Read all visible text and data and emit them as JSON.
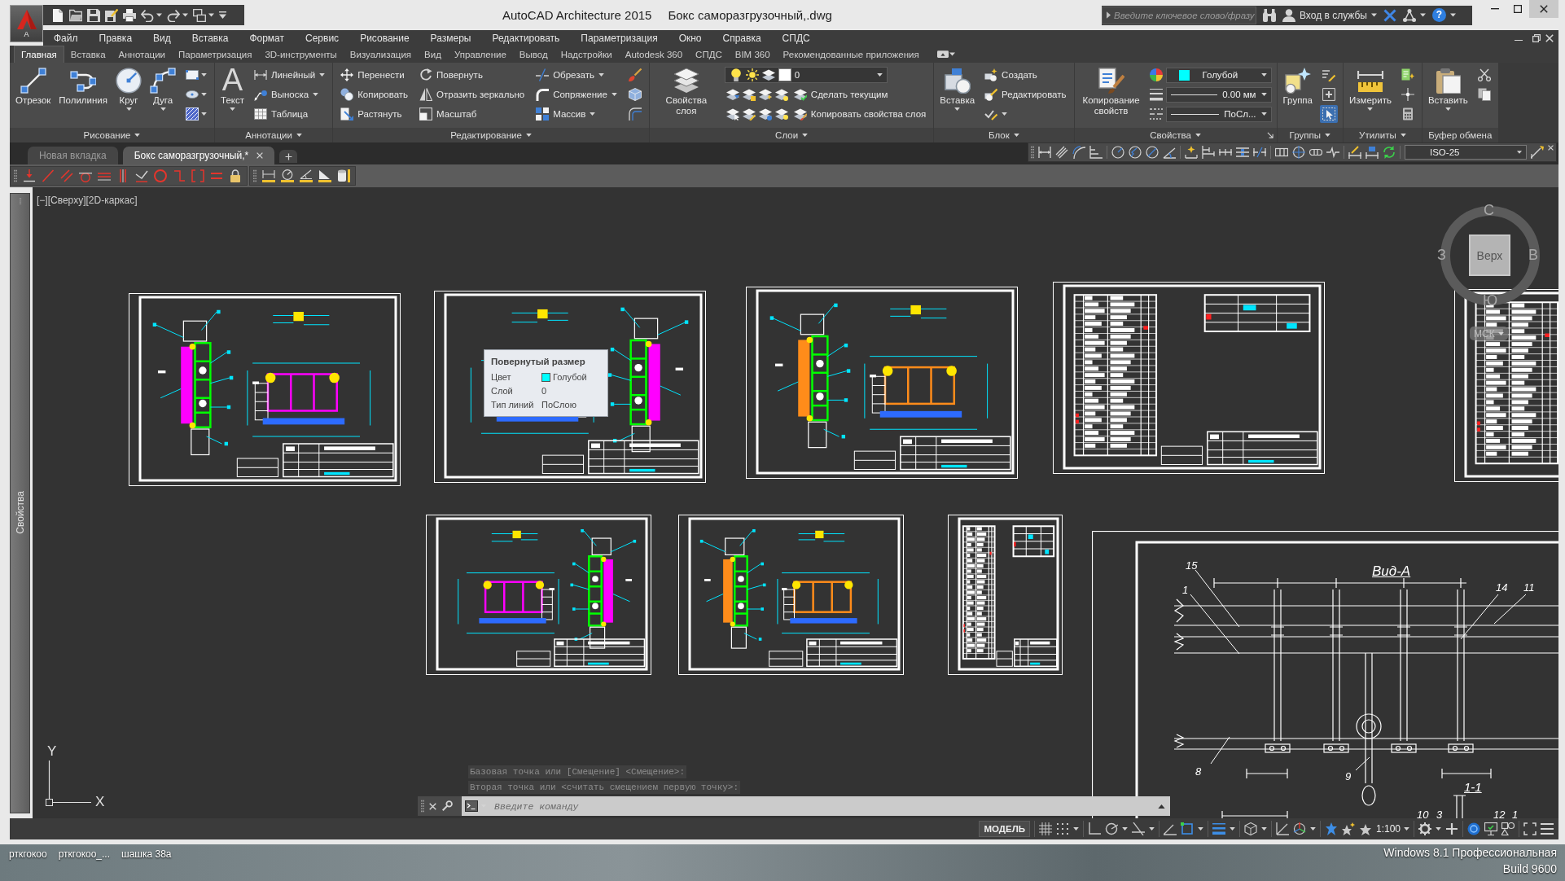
{
  "title_bar": {
    "app_label": "A",
    "app_name": "AutoCAD Architecture 2015",
    "file_name": "Бокс саморазгрузочный,.dwg",
    "search": {
      "placeholder": "Введите ключевое слово/фразу"
    },
    "sign_in": "Вход в службы",
    "help": "?"
  },
  "menu_bar": [
    "Файл",
    "Правка",
    "Вид",
    "Вставка",
    "Формат",
    "Сервис",
    "Рисование",
    "Размеры",
    "Редактировать",
    "Параметризация",
    "Окно",
    "Справка",
    "СПДС"
  ],
  "ribbon_tabs": [
    {
      "label": "Главная",
      "selected": true
    },
    {
      "label": "Вставка",
      "selected": false
    },
    {
      "label": "Аннотации",
      "selected": false
    },
    {
      "label": "Параметризация",
      "selected": false
    },
    {
      "label": "3D-инструменты",
      "selected": false
    },
    {
      "label": "Визуализация",
      "selected": false
    },
    {
      "label": "Вид",
      "selected": false
    },
    {
      "label": "Управление",
      "selected": false
    },
    {
      "label": "Вывод",
      "selected": false
    },
    {
      "label": "Надстройки",
      "selected": false
    },
    {
      "label": "Autodesk 360",
      "selected": false
    },
    {
      "label": "СПДС",
      "selected": false
    },
    {
      "label": "BIM 360",
      "selected": false
    },
    {
      "label": "Рекомендованные приложения",
      "selected": false
    }
  ],
  "ribbon_panels": [
    {
      "title": "Рисование",
      "menu": true,
      "launcher": false,
      "columns": [
        {
          "kind": "large",
          "label": "Отрезок",
          "dropdown": false
        },
        {
          "kind": "large",
          "label": "Полилиния",
          "dropdown": false
        },
        {
          "kind": "large",
          "label": "Круг",
          "dropdown": true
        },
        {
          "kind": "large",
          "label": "Дуга",
          "dropdown": true
        },
        {
          "kind": "icons",
          "items": [
            {
              "dropdown": true
            },
            {
              "dropdown": true
            },
            {
              "dropdown": true
            }
          ]
        }
      ]
    },
    {
      "title": "Аннотации",
      "menu": true,
      "launcher": false,
      "columns": [
        {
          "kind": "large",
          "glyph": "A",
          "label": "Текст",
          "dropdown": true
        },
        {
          "kind": "small",
          "items": [
            {
              "label": "Линейный",
              "dropdown": true
            },
            {
              "label": "Выноска",
              "dropdown": true
            },
            {
              "label": "Таблица",
              "dropdown": false
            }
          ]
        }
      ]
    },
    {
      "title": "Редактирование",
      "menu": true,
      "launcher": false,
      "columns": [
        {
          "kind": "small",
          "items": [
            {
              "label": "Перенести",
              "dropdown": false
            },
            {
              "label": "Копировать",
              "dropdown": false
            },
            {
              "label": "Растянуть",
              "dropdown": false
            }
          ]
        },
        {
          "kind": "small",
          "items": [
            {
              "label": "Повернуть",
              "dropdown": false
            },
            {
              "label": "Отразить зеркально",
              "dropdown": false
            },
            {
              "label": "Масштаб",
              "dropdown": false
            }
          ]
        },
        {
          "kind": "small",
          "items": [
            {
              "label": "Обрезать",
              "dropdown": true
            },
            {
              "label": "Сопряжение",
              "dropdown": true
            },
            {
              "label": "Массив",
              "dropdown": true
            }
          ]
        },
        {
          "kind": "icons",
          "items": [
            {
              "dropdown": false
            },
            {
              "dropdown": false
            },
            {
              "dropdown": false
            }
          ]
        }
      ]
    },
    {
      "title": "Слои",
      "menu": true,
      "launcher": false,
      "columns": [
        {
          "kind": "large",
          "label": "Свойства слоя",
          "dropdown": false
        },
        {
          "kind": "layers",
          "current_layer": "0",
          "items": [
            {
              "label": "Сделать текущим"
            },
            {
              "label": "Копировать свойства слоя"
            }
          ]
        }
      ]
    },
    {
      "title": "Блок",
      "menu": true,
      "launcher": false,
      "columns": [
        {
          "kind": "large",
          "label": "Вставка",
          "dropdown": true
        },
        {
          "kind": "small",
          "items": [
            {
              "label": "Создать",
              "dropdown": false
            },
            {
              "label": "Редактировать",
              "dropdown": false
            },
            {
              "dropdown": true
            }
          ]
        }
      ]
    },
    {
      "title": "Свойства",
      "menu": true,
      "launcher": true,
      "columns": [
        {
          "kind": "large",
          "label": "Копирование свойств",
          "dropdown": false
        },
        {
          "kind": "properties",
          "items": [
            {
              "kind": "color",
              "value": "Голубой",
              "color": "#00ffff"
            },
            {
              "kind": "lineweight",
              "value": "0.00 мм"
            },
            {
              "kind": "linetype",
              "value": "ПоСл..."
            }
          ]
        }
      ]
    },
    {
      "title": "Группы",
      "menu": true,
      "launcher": false,
      "columns": [
        {
          "kind": "large",
          "label": "Группа",
          "dropdown": false
        },
        {
          "kind": "icons",
          "items": [
            {
              "dropdown": false,
              "on": false
            },
            {
              "dropdown": false,
              "on": false
            },
            {
              "dropdown": false,
              "on": true
            }
          ]
        }
      ]
    },
    {
      "title": "Утилиты",
      "menu": true,
      "launcher": false,
      "columns": [
        {
          "kind": "large",
          "label": "Измерить",
          "dropdown": true
        },
        {
          "kind": "icons",
          "items": [
            {
              "dropdown": false
            },
            {
              "dropdown": false
            },
            {
              "dropdown": false
            }
          ]
        }
      ]
    },
    {
      "title": "Буфер обмена",
      "menu": false,
      "launcher": false,
      "columns": [
        {
          "kind": "large",
          "label": "Вставить",
          "dropdown": true
        },
        {
          "kind": "icons",
          "items": [
            {
              "dropdown": false
            },
            {
              "dropdown": false
            }
          ]
        }
      ]
    }
  ],
  "document_tabs": [
    {
      "label": "Новая вкладка",
      "selected": false,
      "closable": false
    },
    {
      "label": "Бокс саморазгрузочный,*",
      "selected": true,
      "closable": true
    }
  ],
  "dimension_toolbar": {
    "style": "ISO-25"
  },
  "properties_palette": {
    "label": "Свойства"
  },
  "viewport": {
    "label": "[−][Сверху][2D-каркас]"
  },
  "tooltip": {
    "title": "Повернутый размер",
    "rows": [
      {
        "label": "Цвет",
        "value": "Голубой",
        "color": "#00ffff"
      },
      {
        "label": "Слой",
        "value": "0"
      },
      {
        "label": "Тип линий",
        "value": "ПоСлою"
      }
    ]
  },
  "viewcube": {
    "face": "Верх",
    "north": "С",
    "east": "В",
    "south": "Ю",
    "west": "З",
    "ucs": "МСК"
  },
  "detail_view": {
    "title": "Вид-А",
    "section": "1-1",
    "callouts": [
      "15",
      "1",
      "14",
      "11",
      "8",
      "9",
      "10",
      "3",
      "12",
      "1"
    ]
  },
  "ucs_icon": {
    "x_label": "X",
    "y_label": "Y"
  },
  "command_line": {
    "history": [
      "Базовая точка или [Смещение] <Смещение>:",
      "Вторая точка или <считать смещением первую точку>:"
    ],
    "placeholder": "Введите команду"
  },
  "status_bar": {
    "space": "МОДЕЛЬ",
    "scale": "1:100",
    "toggles": [
      {
        "on": false
      },
      {
        "on": false
      },
      {
        "on": false
      },
      {
        "on": false
      },
      {
        "on": false
      },
      {
        "on": false
      },
      {
        "on": true
      },
      {
        "on": true
      },
      {
        "on": false
      },
      {
        "on": false
      },
      {
        "on": false
      },
      {
        "on": true
      },
      {
        "on": false
      },
      {
        "on": false
      }
    ]
  },
  "desktop": {
    "icons": [
      {
        "label": "рткгокоо"
      },
      {
        "label": "рткгокоо_..."
      },
      {
        "label": "шашка 38а"
      }
    ],
    "edition": "Windows 8.1 Профессиональная",
    "build": "Build 9600"
  }
}
